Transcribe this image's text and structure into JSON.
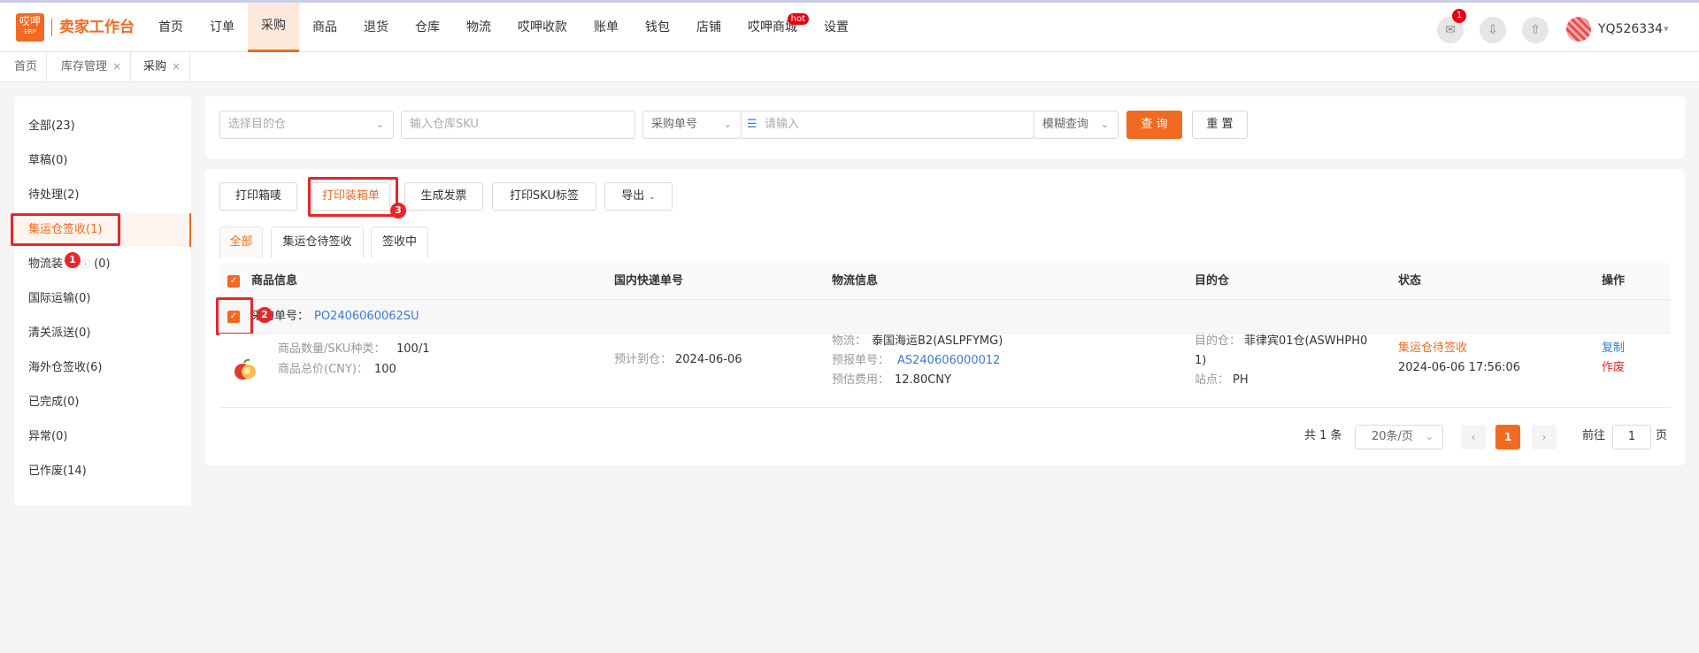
{
  "header": {
    "logo_text": "哎呷",
    "logo_sub": "ERP",
    "brand": "卖家工作台",
    "nav": [
      "首页",
      "订单",
      "采购",
      "商品",
      "退货",
      "仓库",
      "物流",
      "哎呷收款",
      "账单",
      "钱包",
      "店铺",
      "哎呷商城",
      "设置"
    ],
    "hot_label": "hot",
    "notif_count": "1",
    "username": "YQ526334",
    "icons": [
      "notification-icon",
      "download-icon",
      "upload-icon"
    ]
  },
  "page_tabs": [
    {
      "label": "首页",
      "closable": false
    },
    {
      "label": "库存管理",
      "closable": true
    },
    {
      "label": "采购",
      "closable": true
    }
  ],
  "close_glyph": "×",
  "sidebar": {
    "items": [
      "全部(23)",
      "草稿(0)",
      "待处理(2)",
      "集运仓签收(1)",
      "物流装",
      "(0)",
      "国际运输(0)",
      "清关派送(0)",
      "海外仓签收(6)",
      "已完成(0)",
      "异常(0)",
      "已作废(14)"
    ],
    "active_index": 3
  },
  "filters": {
    "warehouse_placeholder": "选择目的仓",
    "sku_placeholder": "输入仓库SKU",
    "order_type": "采购单号",
    "keyword_placeholder": "请输入",
    "match_mode": "模糊查询",
    "search_label": "查 询",
    "reset_label": "重 置"
  },
  "actions": {
    "print_box": "打印箱唛",
    "print_packing": "打印装箱单",
    "invoice": "生成发票",
    "print_sku": "打印SKU标签",
    "export": "导出"
  },
  "status_tabs": [
    "全部",
    "集运仓待签收",
    "签收中"
  ],
  "table": {
    "headers": [
      "商品信息",
      "国内快递单号",
      "物流信息",
      "目的仓",
      "状态",
      "操作"
    ],
    "order_label": "采购单号：",
    "order_no": "PO2406060062SU",
    "row": {
      "qty_label": "商品数量/SKU种类：",
      "qty_value": "100/1",
      "total_label": "商品总价(CNY)：",
      "total_value": "100",
      "eta_label": "预计到仓：",
      "eta_value": "2024-06-06",
      "logistics_label": "物流：",
      "logistics_value": "泰国海运B2(ASLPFYMG)",
      "forecast_label": "预报单号：",
      "forecast_value": "AS240606000012",
      "fee_label": "预估费用：",
      "fee_value": "12.80CNY",
      "dest_label": "目的仓：",
      "dest_value_1": "菲律宾01仓(ASWHPH0",
      "dest_value_2": "1)",
      "site_label": "站点：",
      "site_value": "PH",
      "status": "集运仓待签收",
      "status_time": "2024-06-06 17:56:06",
      "op_copy": "复制",
      "op_void": "作废"
    }
  },
  "pagination": {
    "total": "共 1 条",
    "page_size": "20条/页",
    "current": "1",
    "goto_label": "前往",
    "goto_value": "1",
    "page_unit": "页"
  },
  "annotations": [
    "1",
    "2",
    "3"
  ],
  "colors": {
    "accent": "#f26a21",
    "highlight": "#e8262a",
    "link": "#3a7bd5"
  }
}
